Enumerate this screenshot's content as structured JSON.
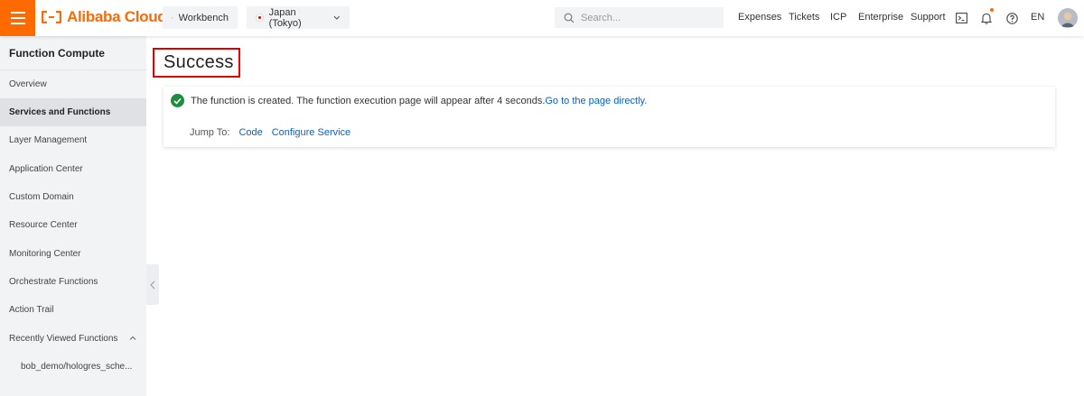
{
  "topbar": {
    "brand": "Alibaba Cloud",
    "workbench_label": "Workbench",
    "region_label": "Japan (Tokyo)",
    "search_placeholder": "Search...",
    "links": [
      "Expenses",
      "Tickets",
      "ICP",
      "Enterprise",
      "Support"
    ],
    "language": "EN",
    "icons": [
      "terminal-icon",
      "bell-icon",
      "help-icon"
    ]
  },
  "sidebar": {
    "title": "Function Compute",
    "items": [
      {
        "label": "Overview",
        "active": false
      },
      {
        "label": "Services and Functions",
        "active": true
      },
      {
        "label": "Layer Management",
        "active": false
      },
      {
        "label": "Application Center",
        "active": false
      },
      {
        "label": "Custom Domain",
        "active": false
      },
      {
        "label": "Resource Center",
        "active": false
      },
      {
        "label": "Monitoring Center",
        "active": false
      },
      {
        "label": "Orchestrate Functions",
        "active": false
      },
      {
        "label": "Action Trail",
        "active": false
      },
      {
        "label": "Recently Viewed Functions",
        "active": false
      }
    ],
    "recent": [
      "bob_demo/hologres_sche..."
    ]
  },
  "main": {
    "title": "Success",
    "message": "The function is created. The function execution page will appear after 4 seconds.",
    "direct_link": "Go to the page directly.",
    "jump_label": "Jump To:",
    "jump_links": [
      "Code",
      "Configure Service"
    ]
  },
  "colors": {
    "brand_orange": "#ff6a00",
    "link_blue": "#0064c8",
    "success_green": "#1e8e3e",
    "highlight_red": "#e00000"
  }
}
